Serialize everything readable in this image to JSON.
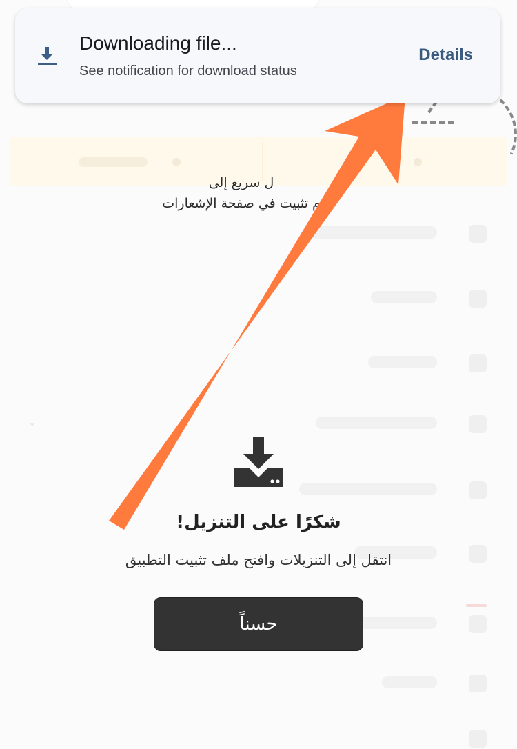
{
  "notification": {
    "title": "Downloading file...",
    "subtitle": "See notification for download status",
    "action_label": "Details",
    "icon": "download-icon"
  },
  "tooltip": {
    "line1": "ل سريع إلى",
    "line2": "م    تثبيت في صفحة الإشعارات"
  },
  "dialog": {
    "icon": "download-tray-icon",
    "title": "شكرًا على التنزيل!",
    "subtitle": "انتقل إلى التنزيلات وافتح ملف تثبيت التطبيق",
    "ok_label": "حسناً"
  },
  "colors": {
    "arrow": "#ff7a3d",
    "button_bg": "#333333",
    "notification_bg": "#f6f8fc",
    "notification_action": "#3a5a80",
    "banner_bg": "#fff9ec"
  }
}
